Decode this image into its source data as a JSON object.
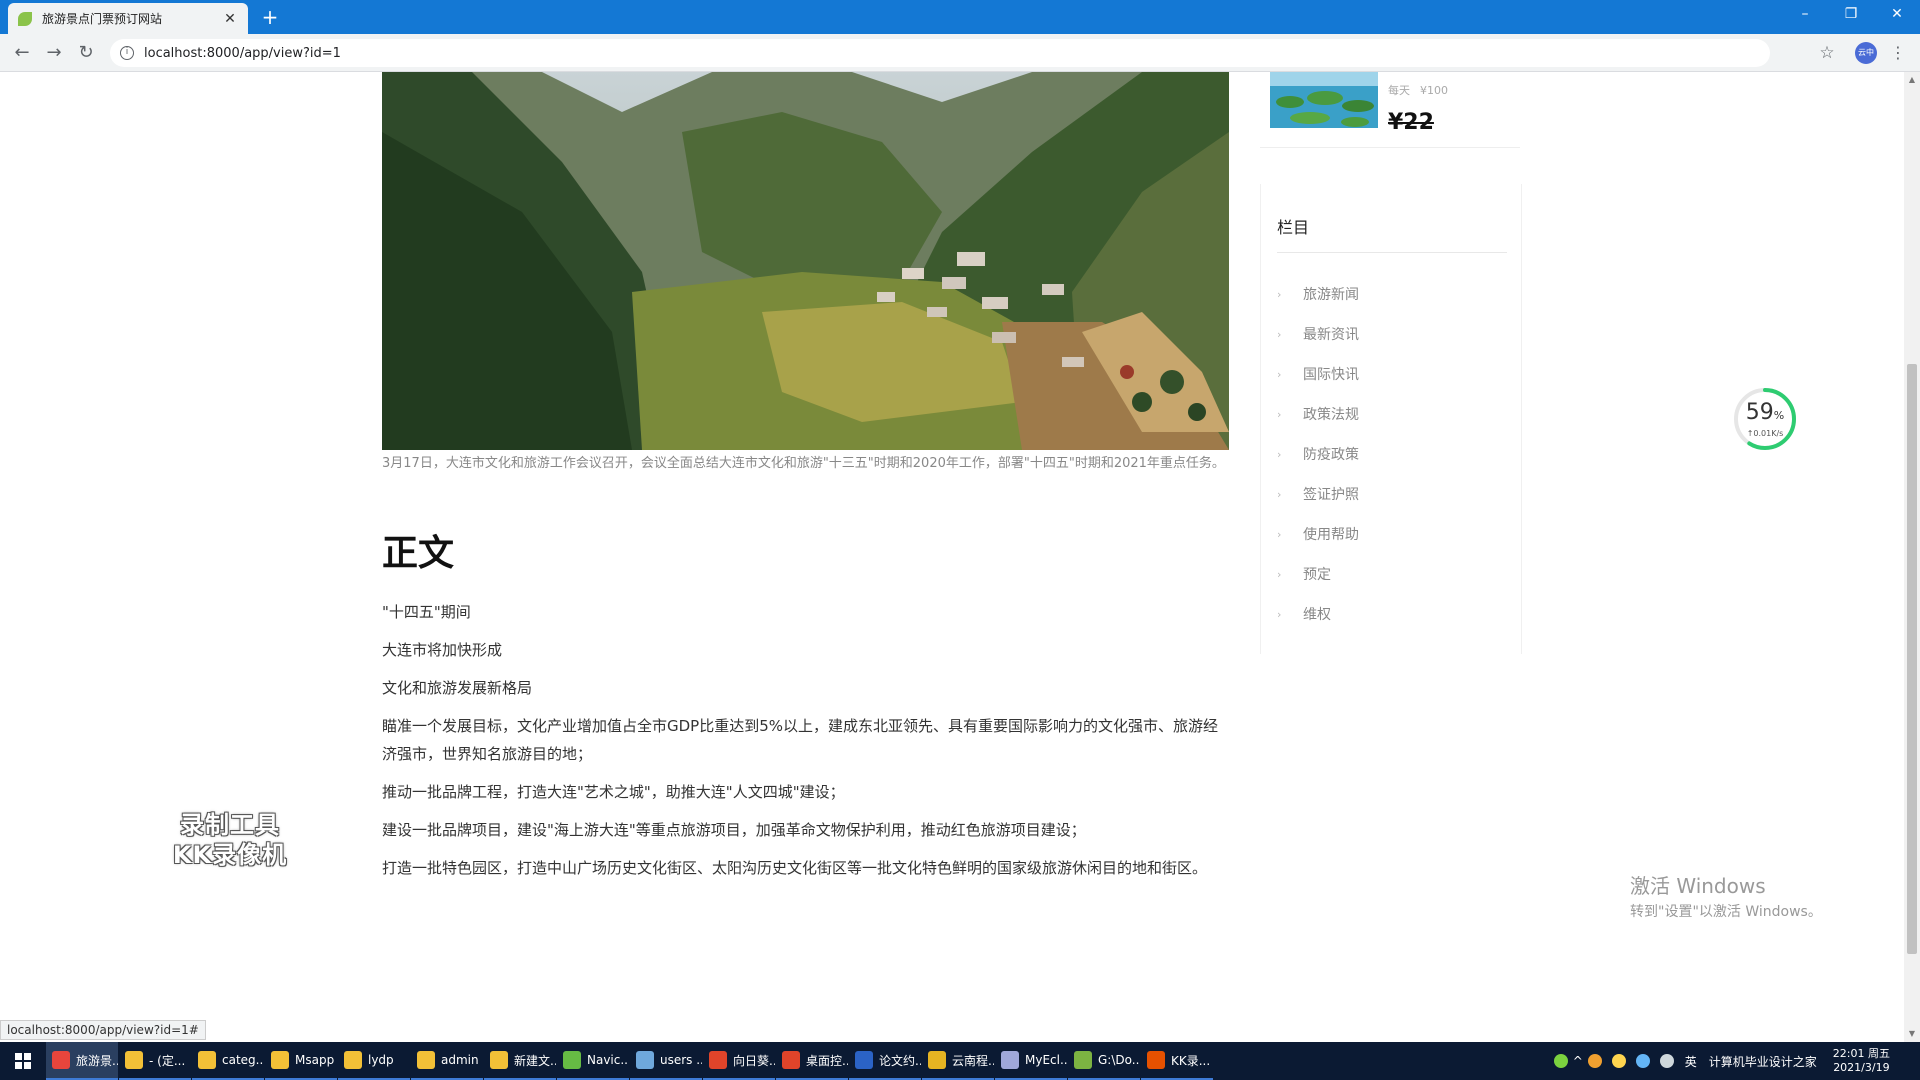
{
  "browser": {
    "tab_title": "旅游景点门票预订网站",
    "tab_close": "✕",
    "new_tab": "+",
    "url": "localhost:8000/app/view?id=1",
    "profile_label": "云中",
    "status_url": "localhost:8000/app/view?id=1#"
  },
  "window_controls": {
    "minimize": "–",
    "restore": "❐",
    "close": "✕"
  },
  "article": {
    "caption": "3月17日，大连市文化和旅游工作会议召开，会议全面总结大连市文化和旅游\"十三五\"时期和2020年工作，部署\"十四五\"时期和2021年重点任务。",
    "section_title": "正文",
    "paragraphs": [
      "\"十四五\"期间",
      "大连市将加快形成",
      "文化和旅游发展新格局",
      "瞄准一个发展目标，文化产业增加值占全市GDP比重达到5%以上，建成东北亚领先、具有重要国际影响力的文化强市、旅游经济强市，世界知名旅游目的地；",
      "推动一批品牌工程，打造大连\"艺术之城\"，助推大连\"人文四城\"建设；",
      "建设一批品牌项目，建设\"海上游大连\"等重点旅游项目，加强革命文物保护利用，推动红色旅游项目建设；",
      "打造一批特色园区，打造中山广场历史文化街区、太阳沟历史文化街区等一批文化特色鲜明的国家级旅游休闲目的地和街区。"
    ]
  },
  "promo": {
    "label": "每天",
    "original_price": "¥100",
    "price": "¥22"
  },
  "categories": {
    "title": "栏目",
    "items": [
      "旅游新闻",
      "最新资讯",
      "国际快讯",
      "政策法规",
      "防疫政策",
      "签证护照",
      "使用帮助",
      "预定",
      "维权"
    ]
  },
  "speed_widget": {
    "percent": "59",
    "percent_unit": "%",
    "rate": "↑0.01K/s",
    "progress": 0.59
  },
  "watermark": {
    "line1": "录制工具",
    "line2": "KK录像机"
  },
  "activation": {
    "line1": "激活 Windows",
    "line2": "转到\"设置\"以激活 Windows。"
  },
  "taskbar": {
    "items": [
      {
        "label": "旅游景...",
        "color": "#e8453c",
        "active": true
      },
      {
        "label": "- (定...",
        "color": "#f2c037",
        "active": false
      },
      {
        "label": "categ...",
        "color": "#f2c037",
        "active": false
      },
      {
        "label": "Msapp",
        "color": "#f2c037",
        "active": false
      },
      {
        "label": "lydp",
        "color": "#f2c037",
        "active": false
      },
      {
        "label": "admin",
        "color": "#f2c037",
        "active": false
      },
      {
        "label": "新建文...",
        "color": "#f2c037",
        "active": false
      },
      {
        "label": "Navic...",
        "color": "#66bb44",
        "active": false
      },
      {
        "label": "users ...",
        "color": "#6fa8dc",
        "active": false
      },
      {
        "label": "向日葵...",
        "color": "#e0442a",
        "active": false
      },
      {
        "label": "桌面控...",
        "color": "#e0442a",
        "active": false
      },
      {
        "label": "论文约...",
        "color": "#2b63c6",
        "active": false
      },
      {
        "label": "云南程...",
        "color": "#e6b422",
        "active": false
      },
      {
        "label": "MyEcl...",
        "color": "#9fa8da",
        "active": false
      },
      {
        "label": "G:\\Do...",
        "color": "#7cb342",
        "active": false
      },
      {
        "label": "KK录...",
        "color": "#e65100",
        "active": false
      }
    ],
    "tray_text": "计算机毕业设计之家",
    "ime": "英",
    "time": "22:01 周五",
    "date": "2021/3/19"
  }
}
